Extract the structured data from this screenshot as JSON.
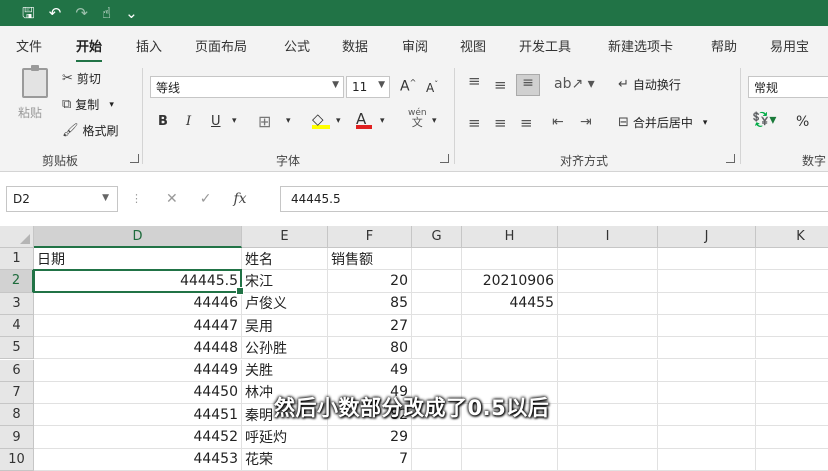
{
  "tabs": [
    "文件",
    "开始",
    "插入",
    "页面布局",
    "公式",
    "数据",
    "审阅",
    "视图",
    "开发工具",
    "新建选项卡",
    "帮助",
    "易用宝"
  ],
  "active_tab": "开始",
  "ribbon": {
    "clipboard": {
      "paste": "粘贴",
      "cut": "剪切",
      "copy": "复制",
      "format_painter": "格式刷",
      "label": "剪贴板"
    },
    "font": {
      "name": "等线",
      "size": "11",
      "bold": "B",
      "italic": "I",
      "underline": "U",
      "grow": "A",
      "shrink": "A",
      "phonetic": "wén",
      "label": "字体"
    },
    "alignment": {
      "wrap": "自动换行",
      "merge": "合并后居中",
      "label": "对齐方式"
    },
    "number": {
      "format": "常规",
      "percent": "%",
      "label": "数字"
    }
  },
  "formula_bar": {
    "name_box": "D2",
    "formula": "44445.5",
    "fx": "fx"
  },
  "columns": [
    "D",
    "E",
    "F",
    "G",
    "H",
    "I",
    "J",
    "K"
  ],
  "selected_column": "D",
  "rows": [
    {
      "num": "1",
      "D": "日期",
      "E": "姓名",
      "F": "销售额",
      "H": ""
    },
    {
      "num": "2",
      "D": "44445.5",
      "E": "宋江",
      "F": "20",
      "H": "20210906"
    },
    {
      "num": "3",
      "D": "44446",
      "E": "卢俊义",
      "F": "85",
      "H": "44455"
    },
    {
      "num": "4",
      "D": "44447",
      "E": "吴用",
      "F": "27",
      "H": ""
    },
    {
      "num": "5",
      "D": "44448",
      "E": "公孙胜",
      "F": "80",
      "H": ""
    },
    {
      "num": "6",
      "D": "44449",
      "E": "关胜",
      "F": "49",
      "H": ""
    },
    {
      "num": "7",
      "D": "44450",
      "E": "林冲",
      "F": "49",
      "H": ""
    },
    {
      "num": "8",
      "D": "44451",
      "E": "秦明",
      "F": "82",
      "H": ""
    },
    {
      "num": "9",
      "D": "44452",
      "E": "呼延灼",
      "F": "29",
      "H": ""
    },
    {
      "num": "10",
      "D": "44453",
      "E": "花荣",
      "F": "7",
      "H": ""
    }
  ],
  "selected_row": "2",
  "subtitle": "然后小数部分改成了0.5以后"
}
